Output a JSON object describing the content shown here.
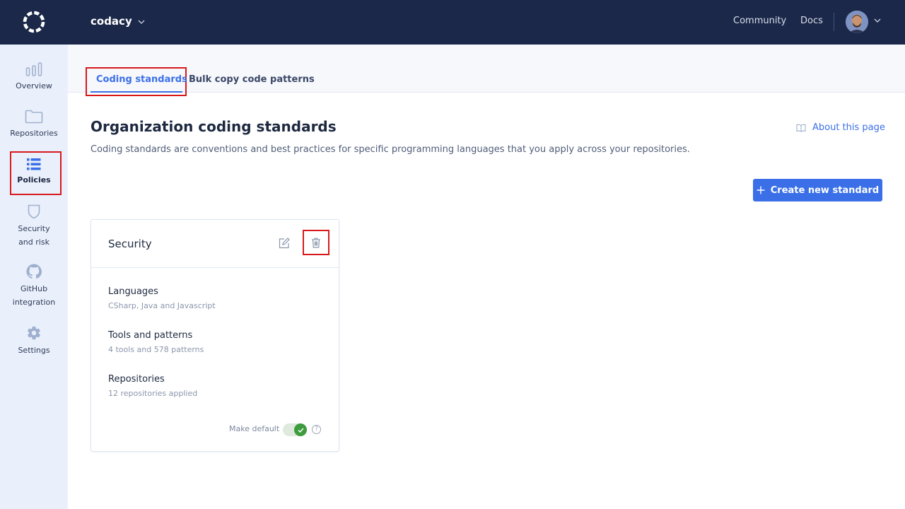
{
  "topbar": {
    "org_name": "codacy",
    "links": {
      "community": "Community",
      "docs": "Docs"
    }
  },
  "sidebar": {
    "items": [
      {
        "label": "Overview",
        "icon": "bar-chart-icon"
      },
      {
        "label": "Repositories",
        "icon": "folder-icon"
      },
      {
        "label": "Policies",
        "icon": "list-icon",
        "active": true
      },
      {
        "label": "Security",
        "label2": "and risk",
        "icon": "shield-icon"
      },
      {
        "label": "GitHub",
        "label2": "integration",
        "icon": "github-icon"
      },
      {
        "label": "Settings",
        "icon": "gear-icon"
      }
    ]
  },
  "tabs": [
    {
      "label": "Coding standards",
      "active": true
    },
    {
      "label": "Bulk copy code patterns"
    }
  ],
  "page": {
    "title": "Organization coding standards",
    "description": "Coding standards are conventions and best practices for specific programming languages that you apply across your repositories.",
    "about_link": "About this page",
    "create_button": "Create new standard"
  },
  "card": {
    "title": "Security",
    "sections": [
      {
        "label": "Languages",
        "value": "CSharp, Java and Javascript"
      },
      {
        "label": "Tools and patterns",
        "value": "4 tools and 578 patterns"
      },
      {
        "label": "Repositories",
        "value": "12 repositories applied"
      }
    ],
    "make_default_label": "Make default",
    "make_default_on": true,
    "help_glyph": "?"
  },
  "colors": {
    "topbar": "#1b2849",
    "accent": "#3a6fe8",
    "sidebar": "#eaf0fb",
    "highlight": "#d7191c",
    "toggle_on": "#3e9b3e"
  }
}
